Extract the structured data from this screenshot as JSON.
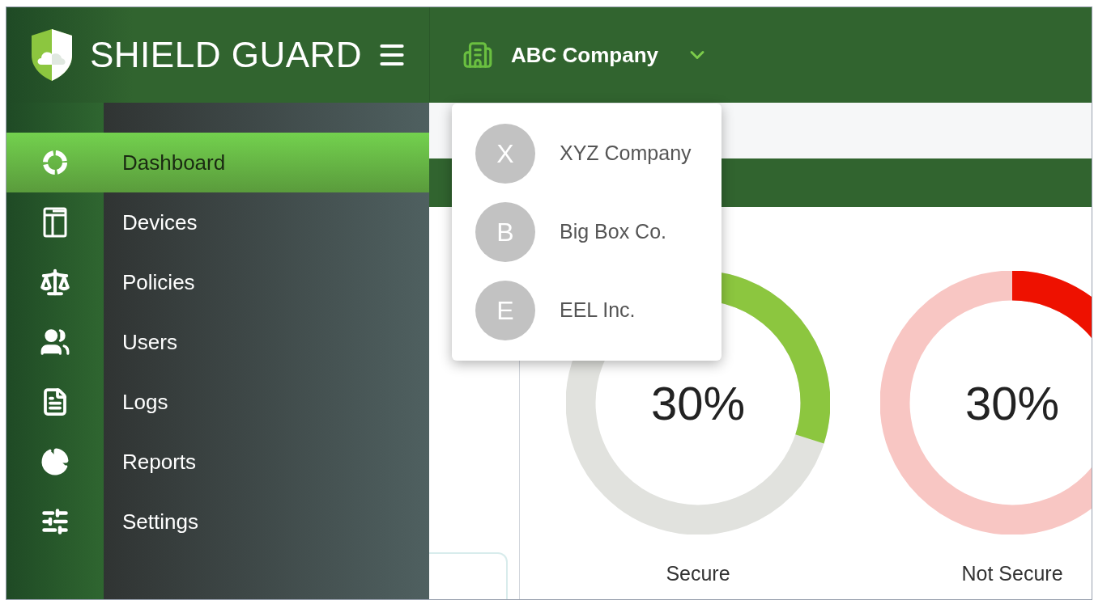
{
  "app": {
    "title": "SHIELD GUARD"
  },
  "company_switcher": {
    "label": "ABC Company",
    "expanded": true
  },
  "company_menu": [
    {
      "initial": "X",
      "name": "XYZ Company"
    },
    {
      "initial": "B",
      "name": "Big Box Co."
    },
    {
      "initial": "E",
      "name": "EEL Inc."
    }
  ],
  "sidebar": {
    "items": [
      {
        "label": "Dashboard",
        "selected": true
      },
      {
        "label": "Devices",
        "selected": false
      },
      {
        "label": "Policies",
        "selected": false
      },
      {
        "label": "Users",
        "selected": false
      },
      {
        "label": "Logs",
        "selected": false
      },
      {
        "label": "Reports",
        "selected": false
      },
      {
        "label": "Settings",
        "selected": false
      }
    ]
  },
  "gauges": [
    {
      "kind": "secure",
      "reading": "30%",
      "level": 0.3,
      "label": "Secure"
    },
    {
      "kind": "not_secure",
      "reading": "30%",
      "label": "Not Secure"
    }
  ]
}
